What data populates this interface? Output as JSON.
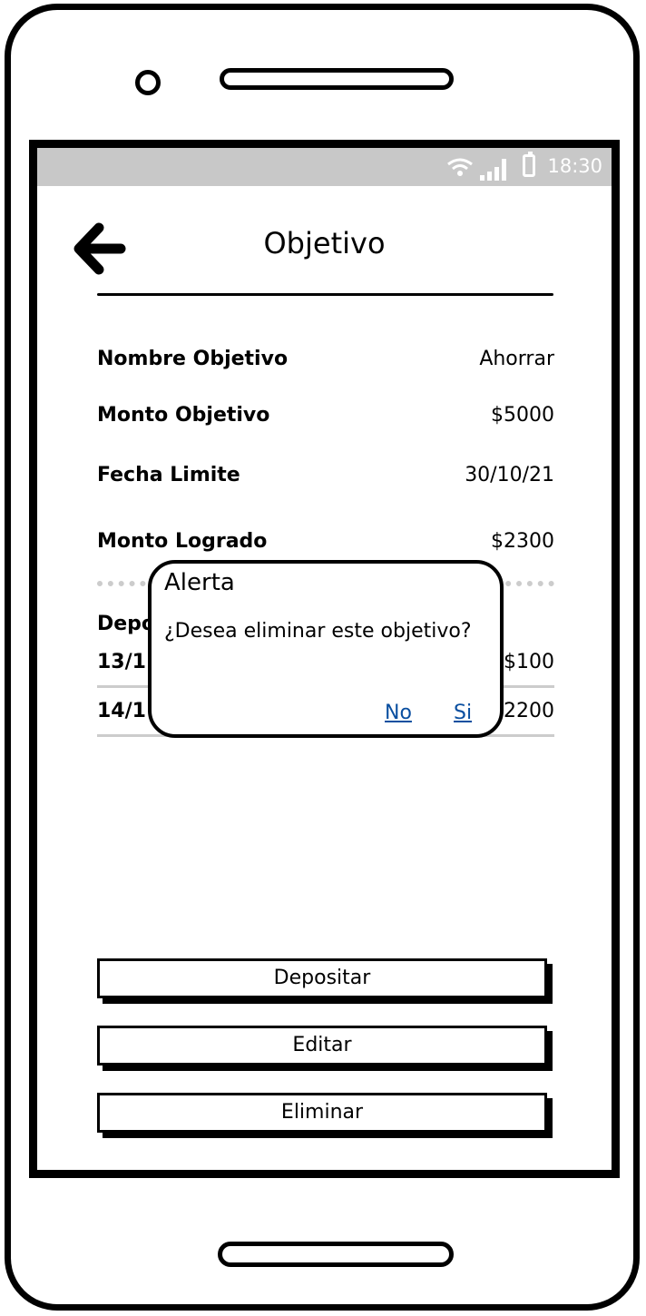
{
  "statusbar": {
    "time": "18:30",
    "icons": [
      "wifi-icon",
      "signal-icon",
      "battery-icon"
    ]
  },
  "header": {
    "title": "Objetivo",
    "back_icon": "arrow-left-icon"
  },
  "details": [
    {
      "label": "Nombre Objetivo",
      "value": "Ahorrar"
    },
    {
      "label": "Monto Objetivo",
      "value": "$5000"
    },
    {
      "label": "Fecha Limite",
      "value": "30/10/21"
    },
    {
      "label": "Monto Logrado",
      "value": "$2300"
    }
  ],
  "deposits": {
    "header": "Depo",
    "rows": [
      {
        "date": "13/1",
        "amount": "$100"
      },
      {
        "date": "14/1",
        "amount": "2200"
      }
    ]
  },
  "buttons": {
    "deposit": "Depositar",
    "edit": "Editar",
    "delete": "Eliminar"
  },
  "dialog": {
    "title": "Alerta",
    "message": "¿Desea eliminar este objetivo?",
    "no_label": "No",
    "yes_label": "Si",
    "link_color": "#0a4fa0"
  }
}
